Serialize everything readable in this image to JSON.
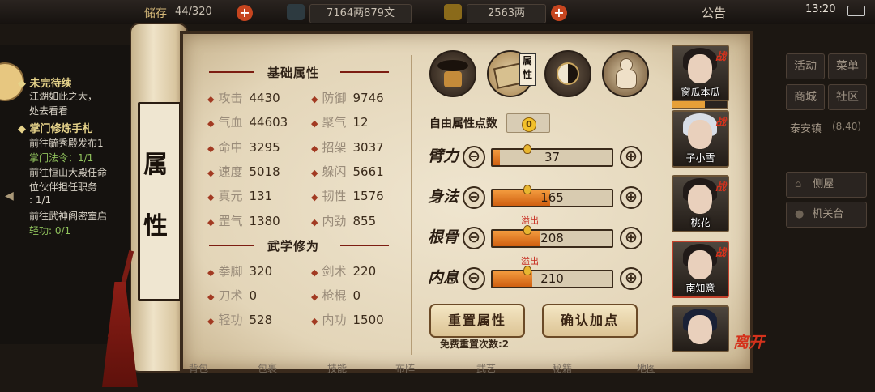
{
  "top_bar": {
    "storage_label": "储存",
    "storage_value": "44/320",
    "money": "7164两879文",
    "gold": "2563两",
    "announcement": "公告",
    "time": "13:20"
  },
  "quests": {
    "title1": "未完待续",
    "lines1": [
      "江湖如此之大，",
      "处去看看"
    ],
    "title2": "掌门修炼手札",
    "lines2": [
      "前往毓秀殿发布1",
      "掌门法令：1/1",
      "前往恒山大殿任命",
      "位伙伴担任职务",
      ": 1/1",
      "前往武神阁密室启",
      "轻功: 0/1"
    ]
  },
  "scroll_title": [
    "属",
    "性"
  ],
  "basic_section_title": "基础属性",
  "basic_attrs": [
    {
      "label": "攻击",
      "value": "4430"
    },
    {
      "label": "防御",
      "value": "9746"
    },
    {
      "label": "气血",
      "value": "44603"
    },
    {
      "label": "聚气",
      "value": "12"
    },
    {
      "label": "命中",
      "value": "3295"
    },
    {
      "label": "招架",
      "value": "3037"
    },
    {
      "label": "速度",
      "value": "5018"
    },
    {
      "label": "躲闪",
      "value": "5661"
    },
    {
      "label": "真元",
      "value": "131"
    },
    {
      "label": "韧性",
      "value": "1576"
    },
    {
      "label": "罡气",
      "value": "1380"
    },
    {
      "label": "内劲",
      "value": "855"
    }
  ],
  "martial_section_title": "武学修为",
  "martial_attrs": [
    {
      "label": "拳脚",
      "value": "320"
    },
    {
      "label": "剑术",
      "value": "220"
    },
    {
      "label": "刀术",
      "value": "0"
    },
    {
      "label": "枪棍",
      "value": "0"
    },
    {
      "label": "轻功",
      "value": "528"
    },
    {
      "label": "内功",
      "value": "1500"
    }
  ],
  "tabs": {
    "icons": [
      "hat-icon",
      "scroll-map-icon",
      "bagua-icon",
      "figure-icon"
    ],
    "active_label": "属性"
  },
  "free_points": {
    "label": "自由属性点数",
    "value": "0"
  },
  "stats": [
    {
      "name": "臂力",
      "value": "37",
      "fill": 0.06,
      "overflow_label": ""
    },
    {
      "name": "身法",
      "value": "165",
      "fill": 0.48,
      "overflow_label": ""
    },
    {
      "name": "根骨",
      "value": "208",
      "fill": 0.4,
      "overflow_label": "溢出"
    },
    {
      "name": "内息",
      "value": "210",
      "fill": 0.33,
      "overflow_label": "溢出"
    }
  ],
  "buttons": {
    "reset": "重置属性",
    "confirm": "确认加点",
    "free_reset_label": "免费重置次数:2"
  },
  "team": [
    {
      "name": "窗瓜本瓜",
      "tag": "战"
    },
    {
      "name": "子小雪",
      "tag": "战"
    },
    {
      "name": "桃花",
      "tag": "战"
    },
    {
      "name": "南知意",
      "tag": "战"
    },
    {
      "name": "",
      "tag": ""
    }
  ],
  "leave_label": "离开",
  "right_menu": {
    "buttons": [
      "活动",
      "菜单",
      "商城",
      "社区"
    ],
    "location": "泰安镇",
    "coords": "(8,40)",
    "rooms": [
      "侧屋",
      "机关台"
    ]
  },
  "bottom_menu": [
    "背包",
    "包裹",
    "技能",
    "布阵",
    "武艺",
    "秘籍",
    "地图"
  ],
  "colors": {
    "accent_red": "#a23a22",
    "bar_orange": "#e6791e",
    "paper": "#e8dcc2"
  }
}
